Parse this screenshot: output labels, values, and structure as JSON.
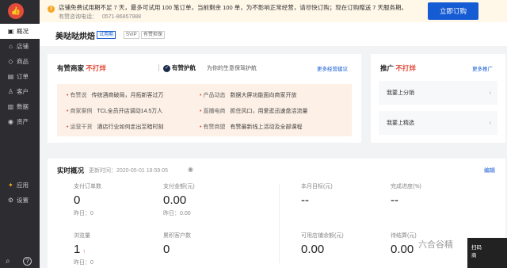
{
  "sidebar": {
    "items": [
      {
        "label": "概况",
        "icon": "overview-icon",
        "glyph": "▣"
      },
      {
        "label": "店铺",
        "icon": "store-icon",
        "glyph": "⌂"
      },
      {
        "label": "商品",
        "icon": "tag-icon",
        "glyph": "◇"
      },
      {
        "label": "订单",
        "icon": "order-icon",
        "glyph": "▤"
      },
      {
        "label": "客户",
        "icon": "customer-icon",
        "glyph": "♙"
      },
      {
        "label": "数据",
        "icon": "data-icon",
        "glyph": "▥"
      },
      {
        "label": "资产",
        "icon": "asset-icon",
        "glyph": "◉"
      }
    ],
    "bottom_items": [
      {
        "label": "应用",
        "icon": "apps-icon",
        "glyph": "✦"
      },
      {
        "label": "设置",
        "icon": "settings-icon",
        "glyph": "⚙"
      }
    ]
  },
  "banner": {
    "message": "店铺免费试用期不足 7 天，最多可试用 100 笔订单，当前剩余 100 单，为不影响正常经营，请尽快订购；现在订购赠送 7 天服务期。",
    "phone_label": "有赞咨询电话：",
    "phone": "0571-86857988",
    "order_button": "立即订购"
  },
  "shop": {
    "name": "美哒哒烘焙",
    "tags": [
      "试用期",
      "SVIP",
      "有赞担保"
    ]
  },
  "merchant_card": {
    "title_prefix": "有赞商家",
    "title_highlight": "不打烊",
    "shield_name": "有赞护航",
    "shield_desc": "为你的生意保驾护航",
    "more": "更多经营建议",
    "features": [
      {
        "key": "有赞说",
        "text": "传统酒商破局，月拓新客过万"
      },
      {
        "key": "产品动态",
        "text": "数据大屏功能面向商家开放"
      },
      {
        "key": "商家案例",
        "text": "TCL全员开店调动14.5万人"
      },
      {
        "key": "直播电商",
        "text": "抓住风口，用爱逛迅速盘活流量"
      },
      {
        "key": "运营干货",
        "text": "酒店行业如何走出至暗时刻"
      },
      {
        "key": "有赞商盟",
        "text": "有赞最新线上活动及全部课程"
      }
    ]
  },
  "promo_card": {
    "title_prefix": "推广",
    "title_highlight": "不打烊",
    "more": "更多推广",
    "entries": [
      "我要上分销",
      "我要上精选"
    ]
  },
  "realtime": {
    "title": "实时概况",
    "update_time": "更新时间：2020-05-01 18:59:05",
    "edit": "编辑",
    "metrics": [
      {
        "label": "支付订单数",
        "value": "0",
        "sub": "昨日：0"
      },
      {
        "label": "支付金额(元)",
        "value": "0.00",
        "sub": "昨日：0.00"
      },
      {
        "label": "本月目标(元)",
        "value": "--",
        "sub": ""
      },
      {
        "label": "完成进度(%)",
        "value": "--",
        "sub": ""
      },
      {
        "label": "浏览量",
        "value": "1",
        "sub": "昨日：0",
        "trend": "↑"
      },
      {
        "label": "累积客户数",
        "value": "0",
        "sub": ""
      },
      {
        "label": "可用店铺余额(元)",
        "value": "0.00",
        "sub": ""
      },
      {
        "label": "待结算(元)",
        "value": "0.00",
        "sub": ""
      }
    ]
  },
  "overlay": {
    "watermark": "六合谷精",
    "float_line1": "扫码",
    "float_line2": "商"
  }
}
